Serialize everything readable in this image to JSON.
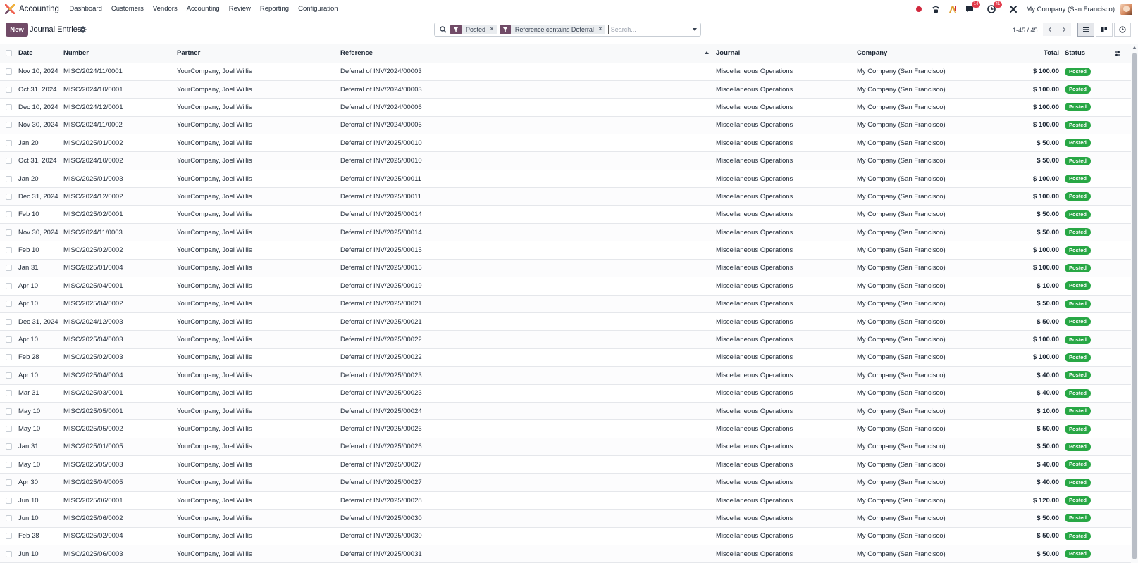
{
  "navbar": {
    "app_name": "Accounting",
    "menu": [
      "Dashboard",
      "Customers",
      "Vendors",
      "Accounting",
      "Review",
      "Reporting",
      "Configuration"
    ],
    "chat_badge": "14",
    "activity_badge": "41",
    "company": "My Company (San Francisco)"
  },
  "control": {
    "new_label": "New",
    "title": "Journal Entries",
    "facets": [
      "Posted",
      "Reference contains Deferral"
    ],
    "search_placeholder": "Search...",
    "pager": "1-45 / 45"
  },
  "columns": {
    "date": "Date",
    "number": "Number",
    "partner": "Partner",
    "reference": "Reference",
    "journal": "Journal",
    "company": "Company",
    "total": "Total",
    "status": "Status"
  },
  "rows": [
    {
      "date": "Nov 10, 2024",
      "number": "MISC/2024/11/0001",
      "partner": "YourCompany, Joel Willis",
      "reference": "Deferral of INV/2024/00003",
      "journal": "Miscellaneous Operations",
      "company": "My Company (San Francisco)",
      "total": "$ 100.00",
      "status": "Posted"
    },
    {
      "date": "Oct 31, 2024",
      "number": "MISC/2024/10/0001",
      "partner": "YourCompany, Joel Willis",
      "reference": "Deferral of INV/2024/00003",
      "journal": "Miscellaneous Operations",
      "company": "My Company (San Francisco)",
      "total": "$ 100.00",
      "status": "Posted"
    },
    {
      "date": "Dec 10, 2024",
      "number": "MISC/2024/12/0001",
      "partner": "YourCompany, Joel Willis",
      "reference": "Deferral of INV/2024/00006",
      "journal": "Miscellaneous Operations",
      "company": "My Company (San Francisco)",
      "total": "$ 100.00",
      "status": "Posted"
    },
    {
      "date": "Nov 30, 2024",
      "number": "MISC/2024/11/0002",
      "partner": "YourCompany, Joel Willis",
      "reference": "Deferral of INV/2024/00006",
      "journal": "Miscellaneous Operations",
      "company": "My Company (San Francisco)",
      "total": "$ 100.00",
      "status": "Posted"
    },
    {
      "date": "Jan 20",
      "number": "MISC/2025/01/0002",
      "partner": "YourCompany, Joel Willis",
      "reference": "Deferral of INV/2025/00010",
      "journal": "Miscellaneous Operations",
      "company": "My Company (San Francisco)",
      "total": "$ 50.00",
      "status": "Posted"
    },
    {
      "date": "Oct 31, 2024",
      "number": "MISC/2024/10/0002",
      "partner": "YourCompany, Joel Willis",
      "reference": "Deferral of INV/2025/00010",
      "journal": "Miscellaneous Operations",
      "company": "My Company (San Francisco)",
      "total": "$ 50.00",
      "status": "Posted"
    },
    {
      "date": "Jan 20",
      "number": "MISC/2025/01/0003",
      "partner": "YourCompany, Joel Willis",
      "reference": "Deferral of INV/2025/00011",
      "journal": "Miscellaneous Operations",
      "company": "My Company (San Francisco)",
      "total": "$ 100.00",
      "status": "Posted"
    },
    {
      "date": "Dec 31, 2024",
      "number": "MISC/2024/12/0002",
      "partner": "YourCompany, Joel Willis",
      "reference": "Deferral of INV/2025/00011",
      "journal": "Miscellaneous Operations",
      "company": "My Company (San Francisco)",
      "total": "$ 100.00",
      "status": "Posted"
    },
    {
      "date": "Feb 10",
      "number": "MISC/2025/02/0001",
      "partner": "YourCompany, Joel Willis",
      "reference": "Deferral of INV/2025/00014",
      "journal": "Miscellaneous Operations",
      "company": "My Company (San Francisco)",
      "total": "$ 50.00",
      "status": "Posted"
    },
    {
      "date": "Nov 30, 2024",
      "number": "MISC/2024/11/0003",
      "partner": "YourCompany, Joel Willis",
      "reference": "Deferral of INV/2025/00014",
      "journal": "Miscellaneous Operations",
      "company": "My Company (San Francisco)",
      "total": "$ 50.00",
      "status": "Posted"
    },
    {
      "date": "Feb 10",
      "number": "MISC/2025/02/0002",
      "partner": "YourCompany, Joel Willis",
      "reference": "Deferral of INV/2025/00015",
      "journal": "Miscellaneous Operations",
      "company": "My Company (San Francisco)",
      "total": "$ 100.00",
      "status": "Posted"
    },
    {
      "date": "Jan 31",
      "number": "MISC/2025/01/0004",
      "partner": "YourCompany, Joel Willis",
      "reference": "Deferral of INV/2025/00015",
      "journal": "Miscellaneous Operations",
      "company": "My Company (San Francisco)",
      "total": "$ 100.00",
      "status": "Posted"
    },
    {
      "date": "Apr 10",
      "number": "MISC/2025/04/0001",
      "partner": "YourCompany, Joel Willis",
      "reference": "Deferral of INV/2025/00019",
      "journal": "Miscellaneous Operations",
      "company": "My Company (San Francisco)",
      "total": "$ 10.00",
      "status": "Posted"
    },
    {
      "date": "Apr 10",
      "number": "MISC/2025/04/0002",
      "partner": "YourCompany, Joel Willis",
      "reference": "Deferral of INV/2025/00021",
      "journal": "Miscellaneous Operations",
      "company": "My Company (San Francisco)",
      "total": "$ 50.00",
      "status": "Posted"
    },
    {
      "date": "Dec 31, 2024",
      "number": "MISC/2024/12/0003",
      "partner": "YourCompany, Joel Willis",
      "reference": "Deferral of INV/2025/00021",
      "journal": "Miscellaneous Operations",
      "company": "My Company (San Francisco)",
      "total": "$ 50.00",
      "status": "Posted"
    },
    {
      "date": "Apr 10",
      "number": "MISC/2025/04/0003",
      "partner": "YourCompany, Joel Willis",
      "reference": "Deferral of INV/2025/00022",
      "journal": "Miscellaneous Operations",
      "company": "My Company (San Francisco)",
      "total": "$ 100.00",
      "status": "Posted"
    },
    {
      "date": "Feb 28",
      "number": "MISC/2025/02/0003",
      "partner": "YourCompany, Joel Willis",
      "reference": "Deferral of INV/2025/00022",
      "journal": "Miscellaneous Operations",
      "company": "My Company (San Francisco)",
      "total": "$ 100.00",
      "status": "Posted"
    },
    {
      "date": "Apr 10",
      "number": "MISC/2025/04/0004",
      "partner": "YourCompany, Joel Willis",
      "reference": "Deferral of INV/2025/00023",
      "journal": "Miscellaneous Operations",
      "company": "My Company (San Francisco)",
      "total": "$ 40.00",
      "status": "Posted"
    },
    {
      "date": "Mar 31",
      "number": "MISC/2025/03/0001",
      "partner": "YourCompany, Joel Willis",
      "reference": "Deferral of INV/2025/00023",
      "journal": "Miscellaneous Operations",
      "company": "My Company (San Francisco)",
      "total": "$ 40.00",
      "status": "Posted"
    },
    {
      "date": "May 10",
      "number": "MISC/2025/05/0001",
      "partner": "YourCompany, Joel Willis",
      "reference": "Deferral of INV/2025/00024",
      "journal": "Miscellaneous Operations",
      "company": "My Company (San Francisco)",
      "total": "$ 10.00",
      "status": "Posted"
    },
    {
      "date": "May 10",
      "number": "MISC/2025/05/0002",
      "partner": "YourCompany, Joel Willis",
      "reference": "Deferral of INV/2025/00026",
      "journal": "Miscellaneous Operations",
      "company": "My Company (San Francisco)",
      "total": "$ 50.00",
      "status": "Posted"
    },
    {
      "date": "Jan 31",
      "number": "MISC/2025/01/0005",
      "partner": "YourCompany, Joel Willis",
      "reference": "Deferral of INV/2025/00026",
      "journal": "Miscellaneous Operations",
      "company": "My Company (San Francisco)",
      "total": "$ 50.00",
      "status": "Posted"
    },
    {
      "date": "May 10",
      "number": "MISC/2025/05/0003",
      "partner": "YourCompany, Joel Willis",
      "reference": "Deferral of INV/2025/00027",
      "journal": "Miscellaneous Operations",
      "company": "My Company (San Francisco)",
      "total": "$ 40.00",
      "status": "Posted"
    },
    {
      "date": "Apr 30",
      "number": "MISC/2025/04/0005",
      "partner": "YourCompany, Joel Willis",
      "reference": "Deferral of INV/2025/00027",
      "journal": "Miscellaneous Operations",
      "company": "My Company (San Francisco)",
      "total": "$ 40.00",
      "status": "Posted"
    },
    {
      "date": "Jun 10",
      "number": "MISC/2025/06/0001",
      "partner": "YourCompany, Joel Willis",
      "reference": "Deferral of INV/2025/00028",
      "journal": "Miscellaneous Operations",
      "company": "My Company (San Francisco)",
      "total": "$ 120.00",
      "status": "Posted"
    },
    {
      "date": "Jun 10",
      "number": "MISC/2025/06/0002",
      "partner": "YourCompany, Joel Willis",
      "reference": "Deferral of INV/2025/00030",
      "journal": "Miscellaneous Operations",
      "company": "My Company (San Francisco)",
      "total": "$ 50.00",
      "status": "Posted"
    },
    {
      "date": "Feb 28",
      "number": "MISC/2025/02/0004",
      "partner": "YourCompany, Joel Willis",
      "reference": "Deferral of INV/2025/00030",
      "journal": "Miscellaneous Operations",
      "company": "My Company (San Francisco)",
      "total": "$ 50.00",
      "status": "Posted"
    },
    {
      "date": "Jun 10",
      "number": "MISC/2025/06/0003",
      "partner": "YourCompany, Joel Willis",
      "reference": "Deferral of INV/2025/00031",
      "journal": "Miscellaneous Operations",
      "company": "My Company (San Francisco)",
      "total": "$ 50.00",
      "status": "Posted"
    }
  ],
  "colors": {
    "brand": "#714b67",
    "posted": "#28a745",
    "badge": "#e23b4b",
    "record": "#d1283d"
  },
  "icons": {
    "app": "accounting-logo-icon",
    "phone": "phone-icon",
    "ai": "ai-icon",
    "chat": "chat-icon",
    "activity": "clock-icon",
    "tools": "tools-icon",
    "settings": "gear-icon",
    "search": "search-icon",
    "filter": "funnel-icon",
    "column_options": "sliders-icon"
  }
}
